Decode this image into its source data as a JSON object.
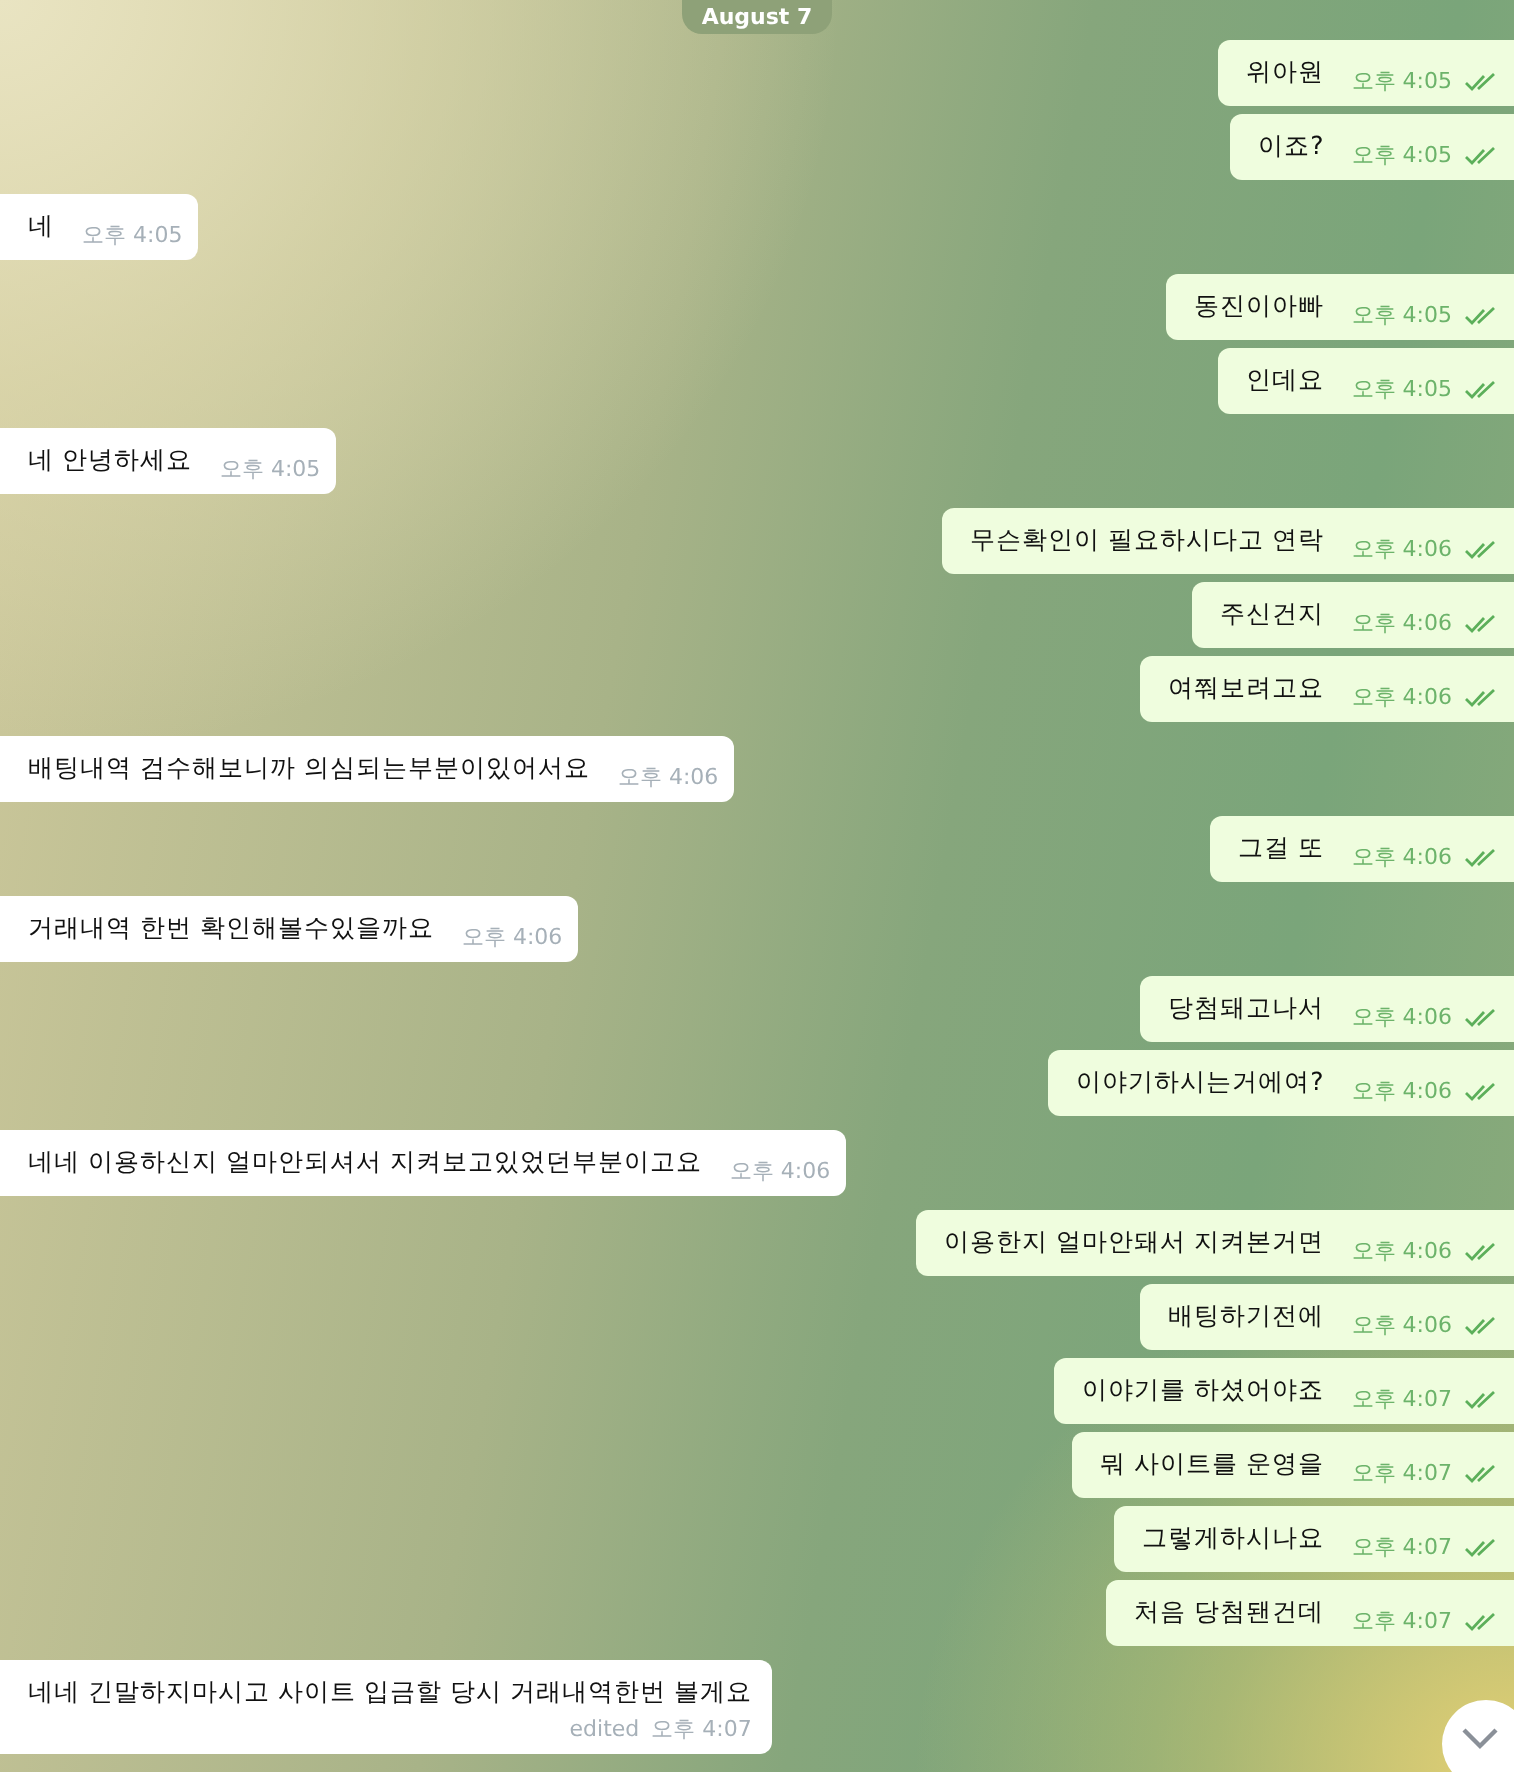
{
  "date_pill": {
    "label": "August 7"
  },
  "messages": [
    {
      "kind": "outgoing",
      "text": "위아원",
      "time": "오후 4:05",
      "read": true
    },
    {
      "kind": "outgoing",
      "text": "이죠?",
      "time": "오후 4:05",
      "read": true
    },
    {
      "kind": "incoming",
      "text": "네",
      "time": "오후 4:05"
    },
    {
      "kind": "outgoing",
      "text": "동진이아빠",
      "time": "오후 4:05",
      "read": true
    },
    {
      "kind": "outgoing",
      "text": "인데요",
      "time": "오후 4:05",
      "read": true
    },
    {
      "kind": "incoming",
      "text": "네 안녕하세요",
      "time": "오후 4:05"
    },
    {
      "kind": "outgoing",
      "text": "무슨확인이 필요하시다고 연락",
      "time": "오후 4:06",
      "read": true
    },
    {
      "kind": "outgoing",
      "text": "주신건지",
      "time": "오후 4:06",
      "read": true
    },
    {
      "kind": "outgoing",
      "text": "여쭤보려고요",
      "time": "오후 4:06",
      "read": true
    },
    {
      "kind": "incoming",
      "text": "배팅내역 검수해보니까 의심되는부분이있어서요",
      "time": "오후 4:06"
    },
    {
      "kind": "outgoing",
      "text": "그걸 또",
      "time": "오후 4:06",
      "read": true
    },
    {
      "kind": "incoming",
      "text": "거래내역 한번 확인해볼수있을까요",
      "time": "오후 4:06"
    },
    {
      "kind": "outgoing",
      "text": "당첨돼고나서",
      "time": "오후 4:06",
      "read": true
    },
    {
      "kind": "outgoing",
      "text": "이야기하시는거에여?",
      "time": "오후 4:06",
      "read": true
    },
    {
      "kind": "incoming",
      "text": "네네 이용하신지 얼마안되셔서 지켜보고있었던부분이고요",
      "time": "오후 4:06"
    },
    {
      "kind": "outgoing",
      "text": "이용한지 얼마안돼서 지켜본거면",
      "time": "오후 4:06",
      "read": true
    },
    {
      "kind": "outgoing",
      "text": "배팅하기전에",
      "time": "오후 4:06",
      "read": true
    },
    {
      "kind": "outgoing",
      "text": "이야기를 하셨어야죠",
      "time": "오후 4:07",
      "read": true
    },
    {
      "kind": "outgoing",
      "text": "뭐 사이트를 운영을",
      "time": "오후 4:07",
      "read": true
    },
    {
      "kind": "outgoing",
      "text": "그렇게하시나요",
      "time": "오후 4:07",
      "read": true
    },
    {
      "kind": "outgoing",
      "text": "처음 당첨됀건데",
      "time": "오후 4:07",
      "read": true
    },
    {
      "kind": "incoming",
      "text": "네네 긴말하지마시고 사이트 입금할 당시 거래내역한번 볼게요",
      "time": "오후 4:07",
      "edited_label": "edited"
    }
  ]
}
